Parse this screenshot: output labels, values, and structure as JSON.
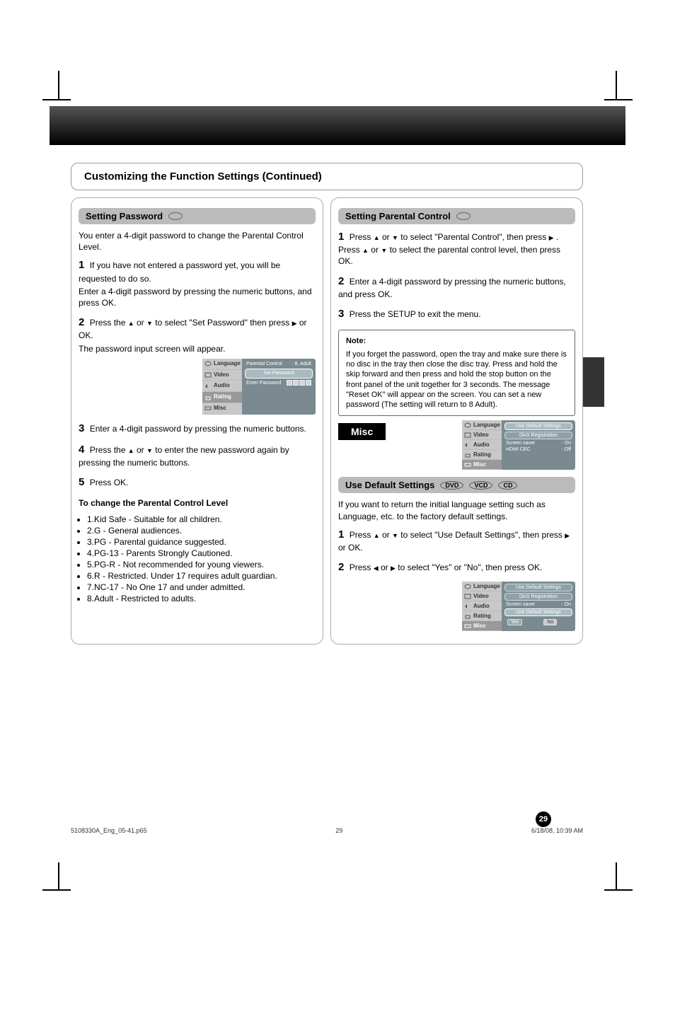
{
  "title_section": "Customizing the Function Settings (Continued)",
  "col_left": {
    "head": "Setting Password",
    "intro": "You enter a 4-digit password to change the Parental Control Level.",
    "step1_label": "1",
    "step1_text": "If you have not entered a password yet, you will be requested to do so.",
    "step1_sub": "Enter a 4-digit password by pressing the numeric buttons, and press OK.",
    "step2_label": "2",
    "step2_text_a": "Press the",
    "step2_text_b": "or",
    "step2_text_c": "to select \"Set Password\" then press",
    "step2_text_d": "or OK.",
    "step2_sub": "The password input screen will appear.",
    "osd1": {
      "tabs": [
        "Language",
        "Video",
        "Audio",
        "Rating",
        "Misc"
      ],
      "row1_label": "Parental Control",
      "row1_val": ": 8. Adult",
      "btn": "Set Password",
      "enter_label": "Enter Password"
    },
    "step3_label": "3",
    "step3_text": "Enter a 4-digit password by pressing the numeric buttons.",
    "step4_label": "4",
    "step4_text_a": "Press the",
    "step4_text_b": "or",
    "step4_text_c": "to enter the new password again by pressing the numeric buttons.",
    "step5_label": "5",
    "step5_text": "Press OK.",
    "levels_intro": "To change the Parental Control Level",
    "levels": [
      "1.Kid Safe - Suitable for all children.",
      "2.G - General audiences.",
      "3.PG - Parental guidance suggested.",
      "4.PG-13 - Parents Strongly Cautioned.",
      "5.PG-R - Not recommended for young viewers.",
      "6.R - Restricted. Under 17 requires adult guardian.",
      "7.NC-17 - No One 17 and under admitted.",
      "8.Adult - Restricted to adults."
    ]
  },
  "col_right": {
    "head": "Setting Parental Control",
    "step1_label": "1",
    "step1_a": "Press",
    "step1_b": "or",
    "step1_c": "to select \"Parental Control\", then press",
    "step1_d": ". Press",
    "step1_e": "or",
    "step1_f": "to select the parental control level, then press OK.",
    "step2_label": "2",
    "step2_text": "Enter a 4-digit password by pressing the numeric buttons, and press OK.",
    "step3_label": "3",
    "step3_text": "Press the SETUP to exit the menu.",
    "note_title": "Note:",
    "note_body": "If you forget the password, open the tray and make sure there is no disc in the tray then close the disc tray. Press and hold the skip forward and then press and hold the stop button on the front panel of the unit together for 3 seconds. The message \"Reset OK\" will appear on the screen. You can set a new password (The setting will return to 8 Adult).",
    "misc_label": "Misc",
    "osd2": {
      "tabs": [
        "Language",
        "Video",
        "Audio",
        "Rating",
        "Misc"
      ],
      "btn1": "Use Default Settings",
      "btn2": "DivX Registration",
      "row1_label": "Screen saver",
      "row1_val": ": On",
      "row2_label": "HDMI CEC",
      "row2_val": ": Off"
    },
    "default_head": "Use Default Settings",
    "default_intro": "If you want to return the initial language setting such as Language, etc. to the factory default settings.",
    "d_step1_label": "1",
    "d_step1_a": "Press",
    "d_step1_b": "or",
    "d_step1_c": "to select \"Use Default Settings\", then press",
    "d_step1_d": "or OK.",
    "d_step2_label": "2",
    "d_step2_a": "Press",
    "d_step2_b": "or",
    "d_step2_c": "to select \"Yes\" or \"No\", then press OK.",
    "osd3": {
      "tabs": [
        "Language",
        "Video",
        "Audio",
        "Rating",
        "Misc"
      ],
      "btn1": "Use Default Settings",
      "btn2": "DivX Registration",
      "row1_label": "Screen saver",
      "row1_val": ": On",
      "confirm": "Use Default Settings",
      "yes": "Yes",
      "no": "No"
    },
    "disc_labels": [
      "DVD",
      "VCD",
      "CD"
    ]
  },
  "footer_left": "5108330A_Eng_05-41.p65",
  "footer_center": "29",
  "footer_right": "6/18/08, 10:39 AM",
  "page_num": "29"
}
